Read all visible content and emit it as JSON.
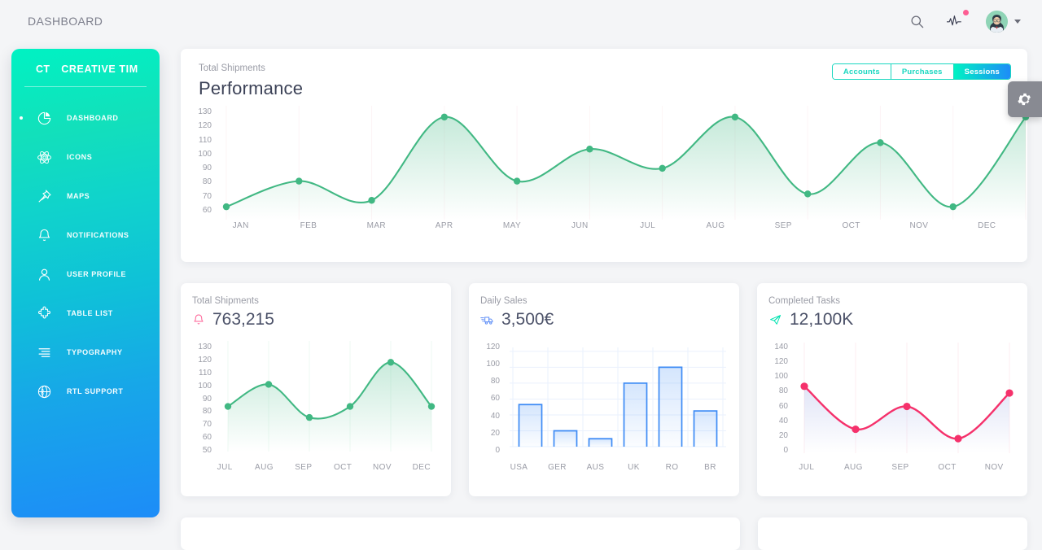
{
  "header": {
    "title": "DASHBOARD",
    "search_icon": "search-icon",
    "activity_icon": "activity-pulse-icon",
    "avatar_icon": "user-avatar",
    "caret_icon": "chevron-down-icon"
  },
  "sidebar": {
    "brand_mini": "CT",
    "brand_name": "CREATIVE TIM",
    "items": [
      {
        "label": "DASHBOARD",
        "icon": "pie-chart-icon",
        "active": true
      },
      {
        "label": "ICONS",
        "icon": "atom-icon",
        "active": false
      },
      {
        "label": "MAPS",
        "icon": "pin-icon",
        "active": false
      },
      {
        "label": "NOTIFICATIONS",
        "icon": "bell-icon",
        "active": false
      },
      {
        "label": "USER PROFILE",
        "icon": "user-icon",
        "active": false
      },
      {
        "label": "TABLE LIST",
        "icon": "puzzle-icon",
        "active": false
      },
      {
        "label": "TYPOGRAPHY",
        "icon": "text-align-icon",
        "active": false
      },
      {
        "label": "RTL SUPPORT",
        "icon": "globe-icon",
        "active": false
      }
    ],
    "gradient_from": "#00f2c3",
    "gradient_to": "#1d8cf8"
  },
  "performance": {
    "label": "Total Shipments",
    "title": "Performance",
    "tabs": [
      {
        "label": "Accounts",
        "active": false
      },
      {
        "label": "Purchases",
        "active": false
      },
      {
        "label": "Sessions",
        "active": true
      }
    ]
  },
  "settings_panel": {
    "gear_icon": "gear-icon"
  },
  "cards": [
    {
      "label": "Total Shipments",
      "value": "763,215",
      "icon": "bell-icon",
      "icon_color": "#fd5d93"
    },
    {
      "label": "Daily Sales",
      "value": "3,500€",
      "icon": "shipping-fast-icon",
      "icon_color": "#5e8ef7"
    },
    {
      "label": "Completed Tasks",
      "value": "12,100K",
      "icon": "send-plane-icon",
      "icon_color": "#00f2c3"
    }
  ],
  "chart_data": [
    {
      "id": "performance",
      "type": "line",
      "title": "Performance",
      "subtitle": "Total Shipments",
      "categories": [
        "JAN",
        "FEB",
        "MAR",
        "APR",
        "MAY",
        "JUN",
        "JUL",
        "AUG",
        "SEP",
        "OCT",
        "NOV",
        "DEC"
      ],
      "values": [
        60,
        80,
        65,
        130,
        80,
        105,
        90,
        130,
        70,
        110,
        60,
        130
      ],
      "yticks": [
        130,
        120,
        110,
        100,
        90,
        80,
        70,
        60
      ],
      "ylim": [
        55,
        135
      ],
      "xlabel": "",
      "ylabel": "",
      "grid": true,
      "legend": "none",
      "line_color": "#41b883",
      "fill_color": "#41b883"
    },
    {
      "id": "total-shipments",
      "type": "line",
      "title": "Total Shipments",
      "categories": [
        "JUL",
        "AUG",
        "SEP",
        "OCT",
        "NOV",
        "DEC"
      ],
      "values": [
        80,
        100,
        70,
        80,
        120,
        80
      ],
      "yticks": [
        130,
        120,
        110,
        100,
        90,
        80,
        70,
        60,
        50
      ],
      "ylim": [
        45,
        135
      ],
      "xlabel": "",
      "ylabel": "",
      "grid": true,
      "legend": "none",
      "line_color": "#41b883",
      "fill_color": "#41b883"
    },
    {
      "id": "daily-sales",
      "type": "bar",
      "title": "Daily Sales",
      "categories": [
        "USA",
        "GER",
        "AUS",
        "UK",
        "RO",
        "BR"
      ],
      "values": [
        53,
        20,
        10,
        80,
        100,
        45
      ],
      "yticks": [
        120,
        100,
        80,
        60,
        40,
        20,
        0
      ],
      "ylim": [
        0,
        125
      ],
      "xlabel": "",
      "ylabel": "",
      "grid": true,
      "legend": "none",
      "bar_color": "#3d8bf5"
    },
    {
      "id": "completed-tasks",
      "type": "line",
      "title": "Completed Tasks",
      "categories": [
        "JUL",
        "AUG",
        "SEP",
        "OCT",
        "NOV"
      ],
      "values": [
        90,
        26,
        60,
        12,
        80
      ],
      "yticks": [
        140,
        120,
        100,
        80,
        60,
        40,
        20,
        0
      ],
      "ylim": [
        0,
        148
      ],
      "xlabel": "",
      "ylabel": "",
      "grid": true,
      "legend": "none",
      "line_color": "#f5316b",
      "fill_color": "#8b9ae0"
    }
  ]
}
